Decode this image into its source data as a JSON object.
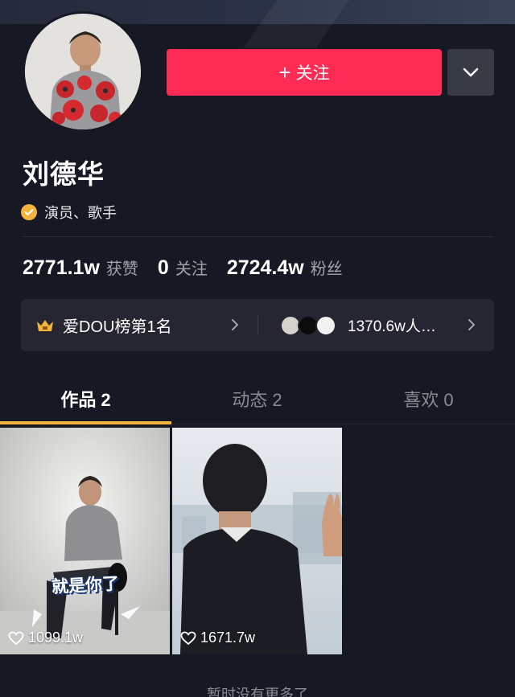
{
  "profile": {
    "follow_label": "关注",
    "name": "刘德华",
    "verify_text": "演员、歌手"
  },
  "stats": [
    {
      "num": "2771.1w",
      "label": "获赞"
    },
    {
      "num": "0",
      "label": "关注"
    },
    {
      "num": "2724.4w",
      "label": "粉丝"
    }
  ],
  "card": {
    "rank_text": "爱DOU榜第1名",
    "fans_text": "1370.6w人…"
  },
  "tabs": [
    {
      "label": "作品 2"
    },
    {
      "label": "动态 2"
    },
    {
      "label": "喜欢 0"
    }
  ],
  "videos": [
    {
      "likes": "1099.1w",
      "caption": "就是你了"
    },
    {
      "likes": "1671.7w"
    }
  ],
  "footer": {
    "no_more": "暂时没有更多了"
  },
  "colors": {
    "accent": "#fe2c55",
    "highlight": "#f6b33b",
    "background": "#161823"
  }
}
